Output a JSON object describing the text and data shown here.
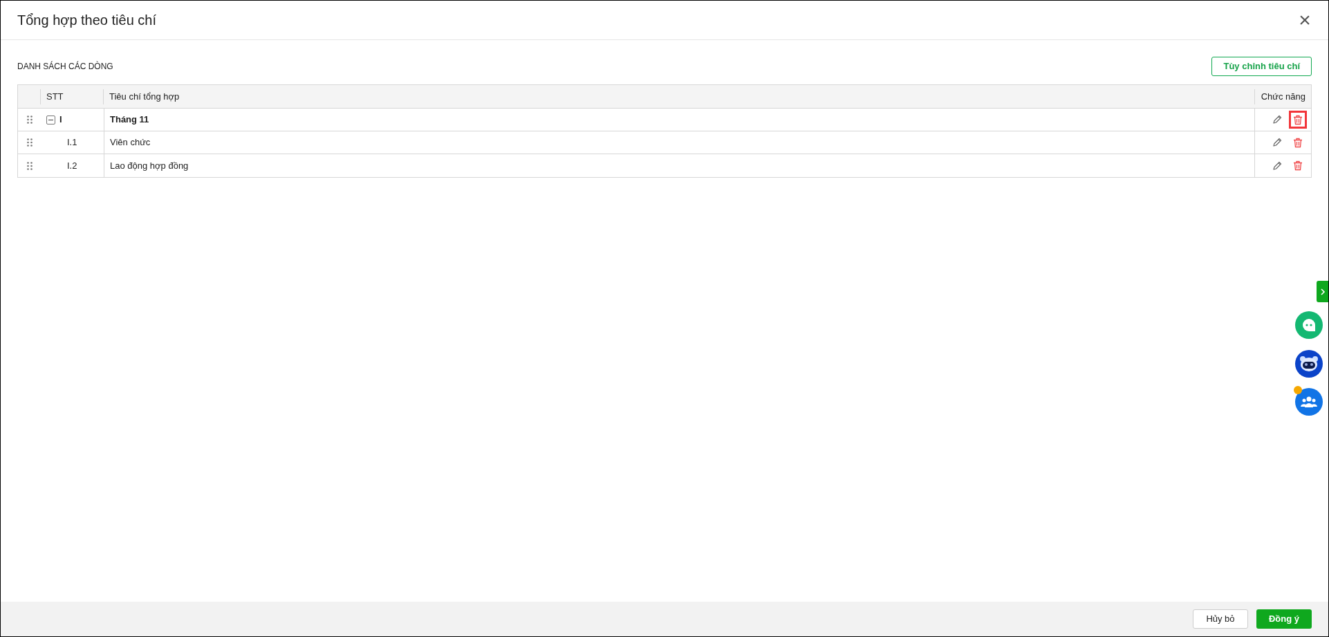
{
  "dialog": {
    "title": "Tổng hợp theo tiêu chí",
    "close": "×"
  },
  "section_title": "DANH SÁCH CÁC DÒNG",
  "customize_button": "Tùy chỉnh tiêu chí",
  "table": {
    "columns": [
      "STT",
      "Tiêu chí tổng hợp",
      "Chức năng"
    ],
    "rows": [
      {
        "stt": "I",
        "name": "Tháng 11",
        "bold": true,
        "expanded": true,
        "delete_highlighted": true,
        "children": [
          {
            "stt": "I.1",
            "name": "Viên chức",
            "bold": false,
            "delete_highlighted": false
          },
          {
            "stt": "I.2",
            "name": "Lao động hợp đồng",
            "bold": false,
            "delete_highlighted": false
          }
        ]
      }
    ]
  },
  "footer": {
    "buttons": [
      {
        "label": "Hủy bỏ",
        "kind": "secondary"
      },
      {
        "label": "Đồng ý",
        "kind": "primary"
      }
    ]
  }
}
